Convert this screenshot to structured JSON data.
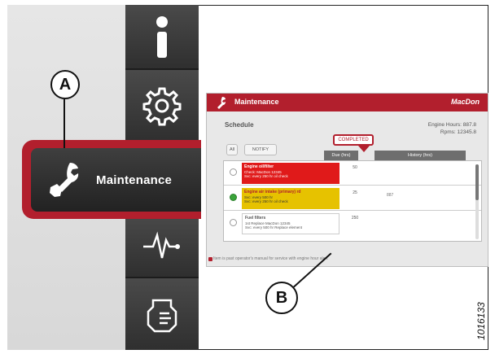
{
  "sidebar": {
    "items": [
      {
        "icon": "info-icon"
      },
      {
        "icon": "gear-icon"
      },
      {
        "icon": "wrench-hand-icon",
        "label": "Maintenance",
        "active": true
      },
      {
        "icon": "pulse-icon"
      },
      {
        "icon": "engine-icon"
      }
    ]
  },
  "callouts": {
    "a": "A",
    "b": "B"
  },
  "inset": {
    "title": "Maintenance",
    "brand": "MacDon",
    "schedule_label": "Schedule",
    "engine_hours": "Engine Hours: 887.8",
    "rpm_hours": "Rpms: 12345.8",
    "filter_all": "All",
    "filter_notify": "NOTIFY",
    "completed": "COMPLETED",
    "columns": {
      "due": "Due (hrs)",
      "history": "History (hrs)"
    },
    "rows": [
      {
        "color": "#e01a1a",
        "title": "Engine oil/filter",
        "lines": [
          "Check: MacDon  12345",
          "Svc: every 250  hr  oil check"
        ],
        "due": "50",
        "history": "",
        "selected": false
      },
      {
        "color": "#e6c200",
        "title": "Engine air intake  (primary) rd",
        "lines": [
          "Svc: every 500  hr",
          "Svc: every 250  hr  oil check"
        ],
        "due": "25",
        "history": "887",
        "selected": true
      },
      {
        "color": "#ffffff",
        "title": "Fuel filters",
        "lines": [
          "1st Replace  MacDon  12345",
          "Svc: every 500  hr  Replace  element"
        ],
        "due": "250",
        "history": "",
        "selected": false
      }
    ],
    "footnote": "Item is past operator's manual for service  with engine hour alert"
  },
  "figure_number": "1016133",
  "colors": {
    "accent": "#b21f2d",
    "sidebar": "#3a3a3a"
  }
}
